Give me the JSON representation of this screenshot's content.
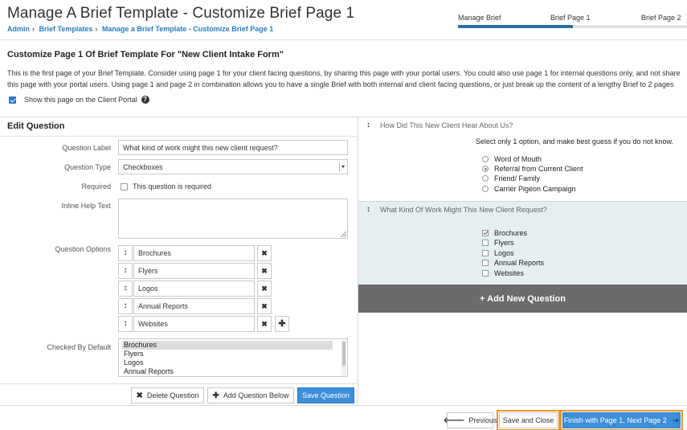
{
  "header": {
    "title": "Manage A Brief Template - Customize Brief Page 1",
    "breadcrumb": [
      "Admin",
      "Brief Templates",
      "Manage a Brief Template - Customize Brief Page 1"
    ],
    "steps": [
      "Manage Brief",
      "Brief Page 1",
      "Brief Page 2"
    ],
    "progress_fraction": 0.5
  },
  "intro": {
    "title": "Customize Page 1 Of Brief Template For \"New Client Intake Form\"",
    "description": "This is the first page of your Brief Template. Consider using page 1 for your client facing questions, by sharing this page with your portal users. You could also use page 1 for internal questions only, and not share this page with your portal users. Using page 1 and page 2 in combination allows you to have a single Brief with both internal and client facing questions, or just break up the content of a lengthy Brief to 2 pages",
    "portal_checkbox_label": "Show this page on the Client Portal",
    "portal_checked": true
  },
  "edit": {
    "heading": "Edit Question",
    "labels": {
      "question_label": "Question Label",
      "question_type": "Question Type",
      "required": "Required",
      "inline_help": "Inline Help Text",
      "question_options": "Question Options",
      "checked_by_default": "Checked By Default"
    },
    "question_label_value": "What kind of work might this new client request?",
    "question_type_value": "Checkboxes",
    "required_text": "This question is required",
    "required_checked": false,
    "inline_help_value": "",
    "options": [
      "Brochures",
      "Flyers",
      "Logos",
      "Annual Reports",
      "Websites"
    ],
    "checked_default_list": [
      "Brochures",
      "Flyers",
      "Logos",
      "Annual Reports"
    ],
    "checked_default_selected": "Brochures",
    "buttons": {
      "delete": "Delete Question",
      "add_below": "Add Question Below",
      "save": "Save Question"
    }
  },
  "preview": {
    "q1": {
      "title": "How Did This New Client Hear About Us?",
      "note": "Select only 1 option, and make best guess if you do not know.",
      "options": [
        "Word of Mouth",
        "Referral from Current Client",
        "Friend/ Family",
        "Carrier Pigeon Campaign"
      ],
      "selected_index": 1
    },
    "q2": {
      "title": "What Kind Of Work Might This New Client Request?",
      "options": [
        "Brochures",
        "Flyers",
        "Logos",
        "Annual Reports",
        "Websites"
      ],
      "checked": [
        true,
        false,
        false,
        false,
        false
      ]
    },
    "add_new": "+ Add New Question"
  },
  "footer": {
    "previous": "Previous",
    "save_close": "Save and Close",
    "finish": "Finish with Page 1, Next Page 2"
  },
  "colors": {
    "accent": "#2d7bc4",
    "step_done": "#2f6f9f",
    "step_todo": "#e3e3e3",
    "selected_question_bg": "#e6eef0",
    "add_question_bg": "#6b6b6b",
    "highlight": "#e8962c"
  }
}
